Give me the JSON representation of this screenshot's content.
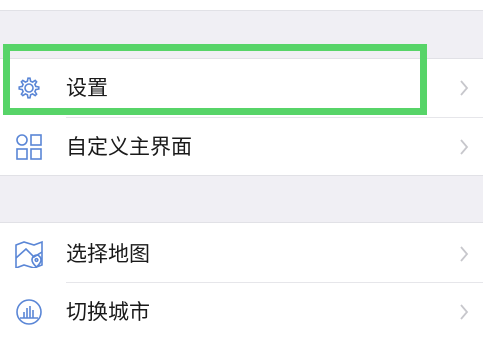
{
  "sections": [
    {
      "items": [
        {
          "label": "设置",
          "icon": "gear-icon"
        },
        {
          "label": "自定义主界面",
          "icon": "layout-grid-icon"
        }
      ]
    },
    {
      "items": [
        {
          "label": "选择地图",
          "icon": "map-icon"
        },
        {
          "label": "切换城市",
          "icon": "city-icon"
        }
      ]
    }
  ],
  "colors": {
    "background": "#f0eff4",
    "row_background": "#ffffff",
    "icon": "#5a86d6",
    "chevron": "#c7c7cc",
    "highlight": "#57d468",
    "text": "#1a1a1a"
  }
}
